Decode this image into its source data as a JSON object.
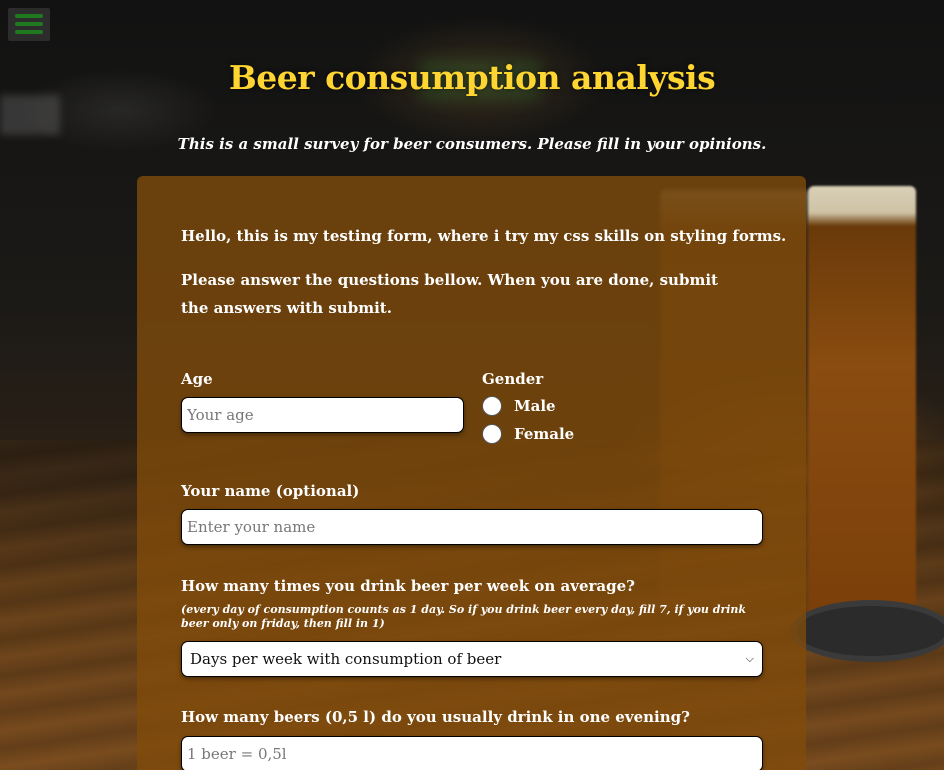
{
  "header": {
    "title": "Beer consumption analysis",
    "subtitle": "This is a small survey for beer consumers. Please fill in your opinions."
  },
  "menu": {
    "icon": "hamburger-icon",
    "color": "#1f7a1f"
  },
  "colors": {
    "title": "#ffd531",
    "card": "#824b0a"
  },
  "form": {
    "intro_1": "Hello, this is my testing form, where i try my css skills on styling forms.",
    "intro_2": "Please answer the questions bellow. When you are done, submit the answers with submit.",
    "age": {
      "label": "Age",
      "placeholder": "Your age"
    },
    "gender": {
      "label": "Gender",
      "options": [
        "Male",
        "Female"
      ]
    },
    "name": {
      "label": "Your name (optional)",
      "placeholder": "Enter your name"
    },
    "times_per_week": {
      "label": "How many times you drink beer per week on average?",
      "hint": "(every day of consumption counts as 1 day. So if you drink beer every day, fill 7, if you drink beer only on friday, then fill in 1)",
      "selected": "Days per week with consumption of beer"
    },
    "beers_per_evening": {
      "label": "How many beers (0,5 l) do you usually drink in one evening?",
      "placeholder": "1 beer = 0,5l"
    }
  }
}
